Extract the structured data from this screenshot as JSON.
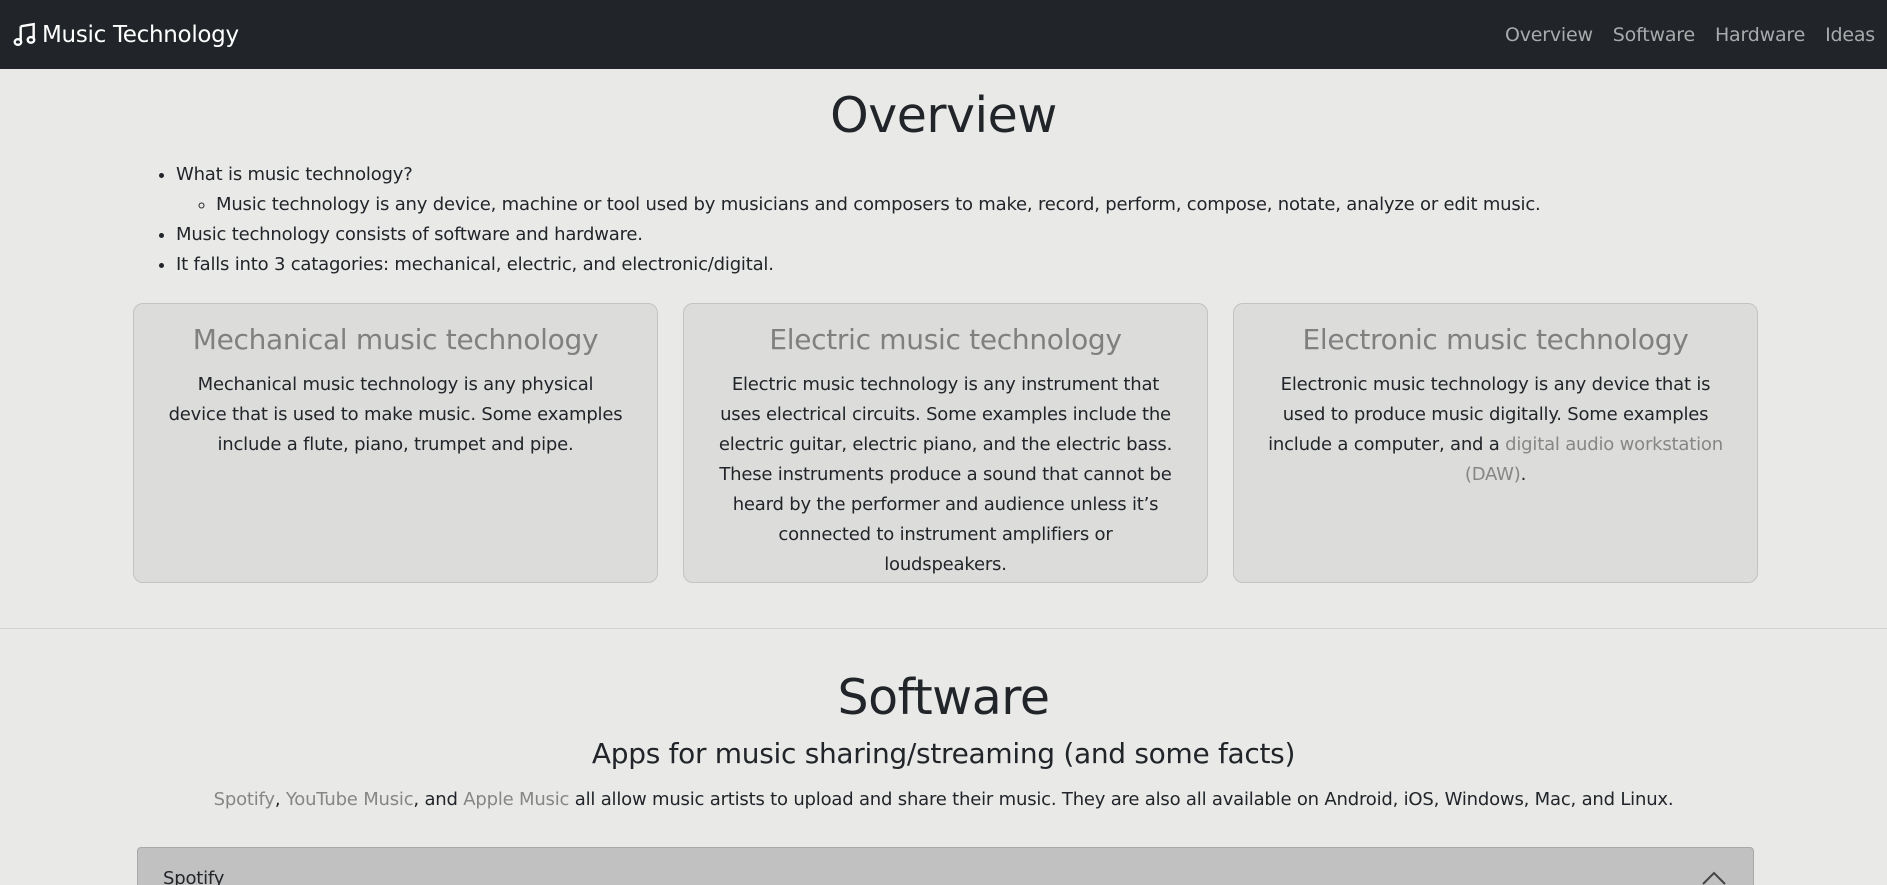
{
  "navbar": {
    "brand": "Music Technology",
    "links": [
      "Overview",
      "Software",
      "Hardware",
      "Ideas"
    ]
  },
  "overview": {
    "title": "Overview",
    "bullets": {
      "b1": "What is music technology?",
      "b1_sub": "Music technology is any device, machine or tool used by musicians and composers to make, record, perform, compose, notate, analyze or edit music.",
      "b2": "Music technology consists of software and hardware.",
      "b3": "It falls into 3 catagories: mechanical, electric, and electronic/digital."
    },
    "cards": [
      {
        "title": "Mechanical music technology",
        "text": "Mechanical music technology is any physical device that is used to make music. Some examples include a flute, piano, trumpet and pipe."
      },
      {
        "title": "Electric music technology",
        "text": "Electric music technology is any instrument that uses electrical circuits. Some examples include the electric guitar, electric piano, and the electric bass. These instruments produce a sound that cannot be heard by the performer and audience unless it’s connected to instrument amplifiers or loudspeakers."
      },
      {
        "title": "Electronic music technology",
        "text_before": "Electronic music technology is any device that is used to produce music digitally. Some examples include a computer, and a ",
        "link": "digital audio workstation (DAW)",
        "text_after": "."
      }
    ]
  },
  "software": {
    "title": "Software",
    "subtitle": "Apps for music sharing/streaming (and some facts)",
    "links": [
      "Spotify",
      "YouTube Music",
      "Apple Music"
    ],
    "sep1": ", ",
    "sep2": ", and ",
    "text_after": " all allow music artists to upload and share their music. They are also all available on Android, iOS, Windows, Mac, and Linux.",
    "accordion": {
      "label": "Spotify"
    }
  },
  "colors": {
    "navbar_bg": "#212529",
    "page_bg": "#e9e9e8",
    "card_bg": "#dcdcdb",
    "link": "#868686",
    "accordion_bg": "#c1c1c1"
  },
  "icons": {
    "brand": "music-note-icon",
    "accordion": "chevron-up-icon"
  }
}
